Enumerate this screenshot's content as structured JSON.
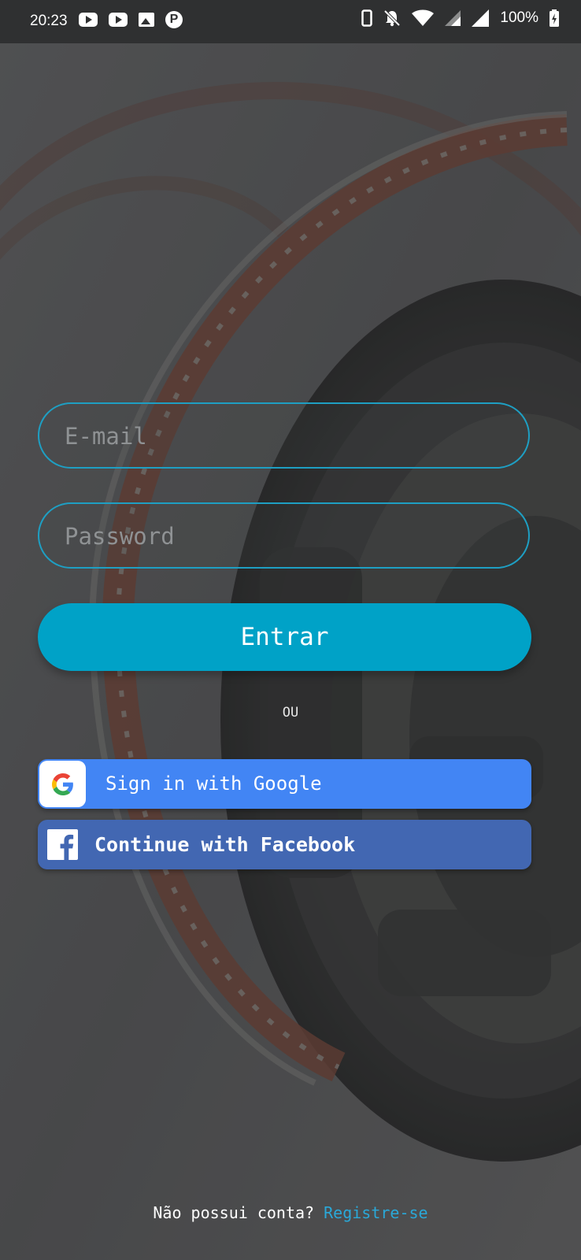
{
  "status_bar": {
    "time": "20:23",
    "left_icons": [
      "youtube-icon",
      "youtube-icon",
      "image-icon",
      "p-icon"
    ],
    "right_icons": [
      "vibrate-icon",
      "notifications-off-icon",
      "wifi-icon",
      "signal-icon",
      "signal-icon",
      "battery-charging-icon"
    ],
    "battery": "100%"
  },
  "login": {
    "email_placeholder": "E-mail",
    "email_value": "",
    "password_placeholder": "Password",
    "password_value": "",
    "submit_label": "Entrar",
    "separator": "OU",
    "google_label": "Sign in with Google",
    "facebook_label": "Continue with Facebook"
  },
  "footer": {
    "prompt": "Não possui conta?",
    "register_link": "Registre-se"
  },
  "colors": {
    "accent": "#00a2c7",
    "field_border": "#1e9fc3",
    "google_blue": "#4285f4",
    "facebook_blue": "#4267b2",
    "link": "#2aa8d8"
  }
}
